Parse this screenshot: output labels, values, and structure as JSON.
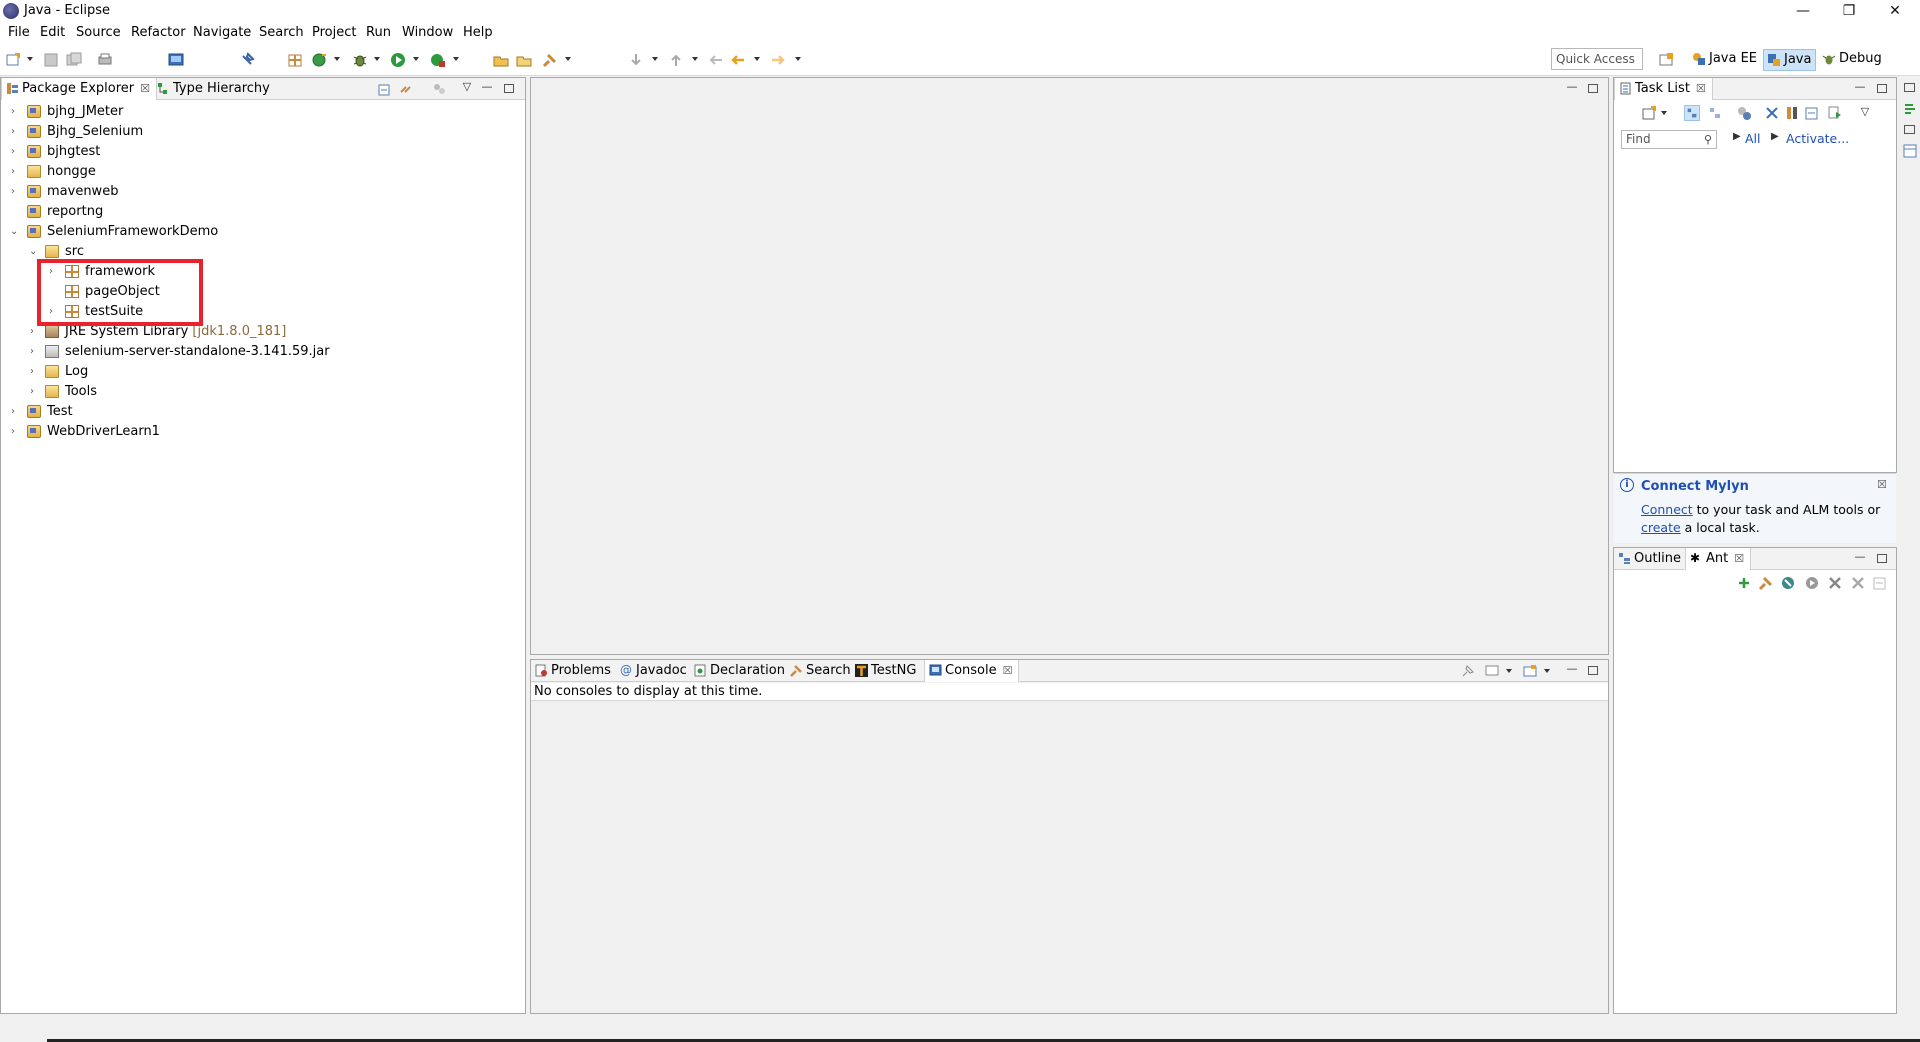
{
  "window": {
    "title": "Java - Eclipse",
    "minimize": "—",
    "restore": "❐",
    "close": "✕"
  },
  "menu": [
    "File",
    "Edit",
    "Source",
    "Refactor",
    "Navigate",
    "Search",
    "Project",
    "Run",
    "Window",
    "Help"
  ],
  "toolbar": {
    "quick_access_placeholder": "Quick Access",
    "perspectives": [
      "Java EE",
      "Java",
      "Debug"
    ]
  },
  "package_explorer": {
    "tabs": [
      {
        "label": "Package Explorer",
        "close": "☒"
      },
      {
        "label": "Type Hierarchy"
      }
    ],
    "tree": [
      {
        "label": "bjhg_JMeter",
        "icon": "project",
        "expanded": false
      },
      {
        "label": "Bjhg_Selenium",
        "icon": "project",
        "expanded": false
      },
      {
        "label": "bjhgtest",
        "icon": "project",
        "expanded": false
      },
      {
        "label": "hongge",
        "icon": "folder",
        "expanded": false
      },
      {
        "label": "mavenweb",
        "icon": "project",
        "expanded": false
      },
      {
        "label": "reportng",
        "icon": "project",
        "expanded": null
      },
      {
        "label": "SeleniumFrameworkDemo",
        "icon": "project",
        "expanded": true
      },
      {
        "label": "src",
        "icon": "folder",
        "expanded": true
      },
      {
        "label": "framework",
        "icon": "package",
        "expanded": false
      },
      {
        "label": "pageObject",
        "icon": "package",
        "expanded": null
      },
      {
        "label": "testSuite",
        "icon": "package",
        "expanded": false
      },
      {
        "label": "JRE System Library",
        "suffix": "[jdk1.8.0_181]",
        "icon": "library",
        "expanded": false
      },
      {
        "label": "selenium-server-standalone-3.141.59.jar",
        "icon": "jar",
        "expanded": false
      },
      {
        "label": "Log",
        "icon": "folder",
        "expanded": false
      },
      {
        "label": "Tools",
        "icon": "folder",
        "expanded": false
      },
      {
        "label": "Test",
        "icon": "project",
        "expanded": false
      },
      {
        "label": "WebDriverLearn1",
        "icon": "project",
        "expanded": false
      }
    ]
  },
  "task_list": {
    "tab_label": "Task List",
    "find_placeholder": "Find",
    "all_label": "All",
    "activate_label": "Activate..."
  },
  "mylyn": {
    "title": "Connect Mylyn",
    "connect_link": "Connect",
    "text_after_connect": " to your task and ALM tools or",
    "create_link": "create",
    "text_after_create": " a local task."
  },
  "outline": {
    "tabs": [
      "Outline",
      "Ant"
    ]
  },
  "console": {
    "tabs": [
      "Problems",
      "Javadoc",
      "Declaration",
      "Search",
      "TestNG",
      "Console"
    ],
    "message": "No consoles to display at this time."
  },
  "colors": {
    "highlight": "#e8232d",
    "link": "#1f4fb3"
  }
}
